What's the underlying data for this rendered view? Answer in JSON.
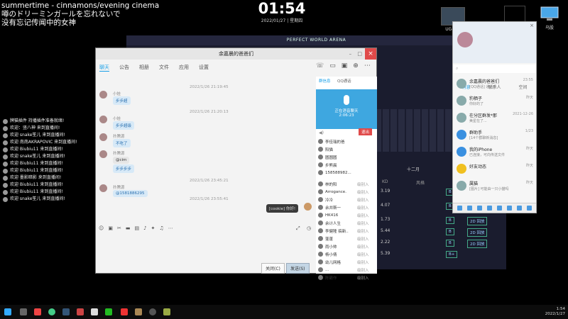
{
  "overlay": {
    "song_title": "summertime - cinnamons/evening cinema",
    "song_line_jp": "噂のドリーミンガールを忘れないで",
    "song_line_cn": "没有忘记传闻中的女神",
    "clock_time": "01:54",
    "clock_date": "2022/01/27 | 星期四"
  },
  "desktop": {
    "icon1_label": "UG-D...",
    "icon2_label": "乌股"
  },
  "game": {
    "title": "PERFECT WORLD ARENA",
    "month": "十二月",
    "col_a": "KD",
    "col_b": "风格",
    "rows": [
      {
        "val": "3.19",
        "badge": "B"
      },
      {
        "val": "4.07",
        "badge": "B"
      },
      {
        "val": "1.73",
        "badge": "B"
      },
      {
        "val": "5.44",
        "badge": "B"
      },
      {
        "val": "2.22",
        "badge": "B"
      },
      {
        "val": "5.39",
        "badge": "B+"
      }
    ],
    "replay_label": "2D 回放"
  },
  "chat": [
    {
      "text": "牌猫插件 持播插件准备就绪!"
    },
    {
      "text": "欢迎：竖八神 来到直播间!"
    },
    {
      "text": "欢迎 snake笙儿 来到直播间!"
    },
    {
      "text": "欢迎 南南AKRAPOVIC 来到直播间!"
    },
    {
      "text": "欢迎 Biubiu11 来到直播间!"
    },
    {
      "text": "欢迎 snake笙儿 来到直播间!"
    },
    {
      "text": "欢迎 Biubiu11 来到直播间!"
    },
    {
      "text": "欢迎 Biubiu11 来到直播间!"
    },
    {
      "text": "欢迎 墨影暗影 来到直播间!"
    },
    {
      "text": "欢迎 Biubiu11 来到直播间!"
    },
    {
      "text": "欢迎 Biubiu11 来到直播间!"
    },
    {
      "text": "欢迎 snake笙儿 来到直播间!"
    }
  ],
  "group_window": {
    "title": "余嘉晨的爸爸们",
    "tabs": [
      "聊天",
      "公告",
      "相册",
      "文件",
      "应用",
      "设置"
    ],
    "messages": [
      {
        "time": "2022/1/26 21:19:45",
        "name": "小娃",
        "text": "步步超"
      },
      {
        "time": "2022/1/26 21:20:13",
        "name": "小娃",
        "text": "步步超级"
      },
      {
        "time": "",
        "name": "扑腾源",
        "text": "不吃了"
      },
      {
        "time": "",
        "name": "扑腾源",
        "text": "@cim"
      },
      {
        "time": "",
        "name": "",
        "text": "步步步步"
      },
      {
        "time": "2022/1/26 23:45:21",
        "name": "扑腾源",
        "text": "@1581886295"
      },
      {
        "time": "2022/1/26 23:55:41",
        "name": "",
        "text": "[cookie] 你好!"
      }
    ],
    "close_btn": "关闭(C)",
    "send_btn": "发送(S)",
    "rtabs": [
      "群信息",
      "QQ通话"
    ],
    "call_status": "正在语音聊天",
    "call_time": "2:06:23",
    "end_btn": "退出",
    "members": [
      {
        "name": "李佳瑞的爸",
        "status": ""
      },
      {
        "name": "阳猫",
        "status": ""
      },
      {
        "name": "圆圆圆",
        "status": ""
      },
      {
        "name": "步熊晨",
        "status": ""
      },
      {
        "name": "158588982...",
        "status": ""
      },
      {
        "name": "林的阳",
        "status": "级别入"
      },
      {
        "name": "Arrogance.",
        "status": "级别入"
      },
      {
        "name": "冷冷",
        "status": "级别入"
      },
      {
        "name": "余并斯一",
        "status": "级别入"
      },
      {
        "name": "HK416",
        "status": "级别入"
      },
      {
        "name": "余计人生",
        "status": "级别入"
      },
      {
        "name": "李健隆 搞新..",
        "status": "级别入"
      },
      {
        "name": "蓬蓬",
        "status": "级别入"
      },
      {
        "name": "雨小帅",
        "status": "级别入"
      },
      {
        "name": "杨小倩",
        "status": "级别入"
      },
      {
        "name": "幼儿网格",
        "status": "级别入"
      },
      {
        "name": "...",
        "status": "级别入"
      },
      {
        "name": "陈霸作",
        "status": "级别入"
      }
    ]
  },
  "qq_main": {
    "tabs": [
      "消息",
      "联系人",
      "空间"
    ],
    "items": [
      {
        "name": "余嘉晨的爸爸们",
        "preview": "[QQ通话] 通话中",
        "time": "23:55"
      },
      {
        "name": "豹栖子",
        "preview": "你好的了",
        "time": "昨天"
      },
      {
        "name": "在分区群发*那",
        "preview": "美星在了...",
        "time": "2021-12-26"
      },
      {
        "name": "群助手",
        "preview": "[14个群聊新消息]",
        "time": "1/23"
      },
      {
        "name": "我的iPhone",
        "preview": "已连接，可向传送文件",
        "time": "昨天"
      },
      {
        "name": "好友动态",
        "preview": "",
        "time": "昨天"
      },
      {
        "name": "属猫",
        "preview": "[图片] 可能由一只小猫吗",
        "time": "昨天"
      }
    ]
  },
  "taskbar": {
    "time": "1:54",
    "date": "2022/1/27"
  }
}
